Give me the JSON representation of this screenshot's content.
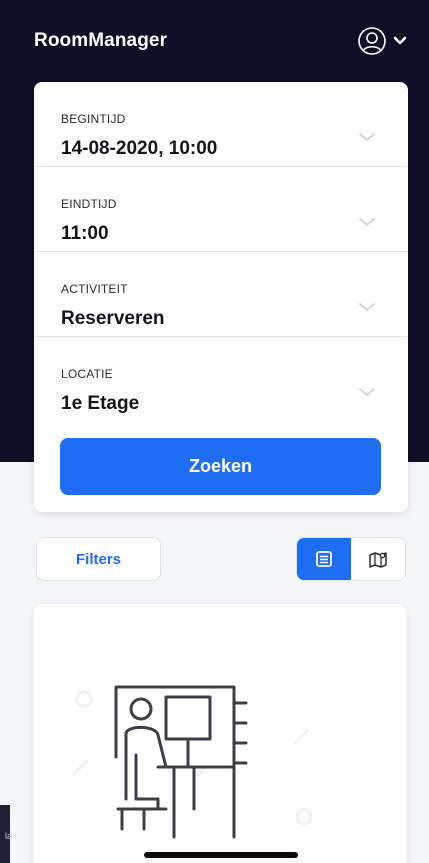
{
  "app": {
    "title": "RoomManager"
  },
  "header": {
    "user_icon": "user-circle-icon",
    "menu_icon": "chevron-down-icon"
  },
  "search_form": {
    "fields": [
      {
        "label": "BEGINTIJD",
        "value": "14-08-2020, 10:00"
      },
      {
        "label": "EINDTIJD",
        "value": "11:00"
      },
      {
        "label": "ACTIVITEIT",
        "value": "Reserveren"
      },
      {
        "label": "LOCATIE",
        "value": "1e Etage"
      }
    ],
    "submit_label": "Zoeken"
  },
  "toolbar": {
    "filters_label": "Filters",
    "view_modes": [
      {
        "icon": "list-icon",
        "active": true
      },
      {
        "icon": "map-icon",
        "active": false
      }
    ]
  },
  "result": {
    "illustration": "person-at-desk-illustration"
  },
  "corner_tab": {
    "text": "la"
  },
  "colors": {
    "header_bg": "#0f1028",
    "accent": "#1f6df2",
    "page_bg": "#f4f5f9",
    "card_bg": "#ffffff"
  }
}
